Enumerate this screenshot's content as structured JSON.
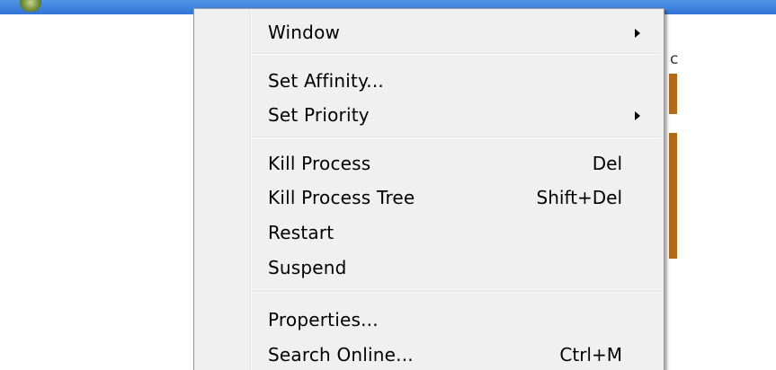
{
  "menu": {
    "items": [
      {
        "label": "Window",
        "shortcut": "",
        "submenu": true
      },
      {
        "label": "Set Affinity...",
        "shortcut": "",
        "submenu": false
      },
      {
        "label": "Set Priority",
        "shortcut": "",
        "submenu": true
      },
      {
        "label": "Kill Process",
        "shortcut": "Del",
        "submenu": false
      },
      {
        "label": "Kill Process Tree",
        "shortcut": "Shift+Del",
        "submenu": false
      },
      {
        "label": "Restart",
        "shortcut": "",
        "submenu": false
      },
      {
        "label": "Suspend",
        "shortcut": "",
        "submenu": false
      },
      {
        "label": "Properties...",
        "shortcut": "",
        "submenu": false
      },
      {
        "label": "Search Online...",
        "shortcut": "Ctrl+M",
        "submenu": false
      }
    ]
  },
  "background": {
    "glyph": "c"
  },
  "colors": {
    "menu_background": "#f0f0f0",
    "menu_border": "#979797",
    "selection_blue": "#3a7fdc",
    "background_accent": "#b06a18"
  }
}
